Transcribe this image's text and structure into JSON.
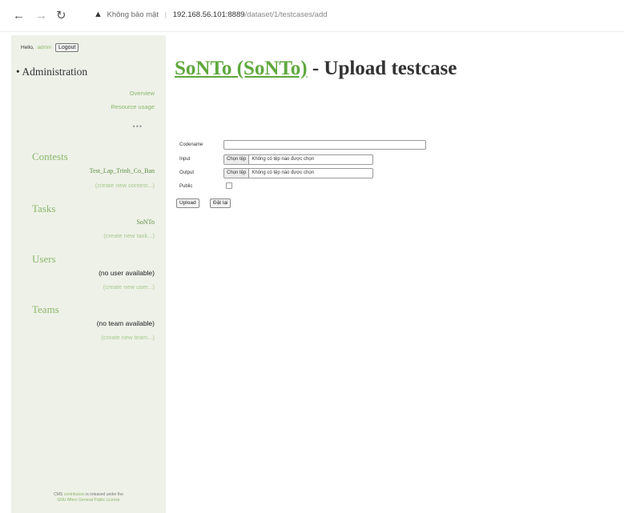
{
  "browser": {
    "security_text": "Không bảo mật",
    "url_host": "192.168.56.101:8889",
    "url_path": "/dataset/1/testcases/add"
  },
  "sidebar": {
    "greeting": "Hello,",
    "username": "admin",
    "logout_label": "Logout",
    "admin_title": "• Administration",
    "admin_links": [
      "Overview",
      "Resource usage"
    ],
    "admin_more": "•••",
    "contests": {
      "title": "Contests",
      "item": "Test_Lap_Trinh_Co_Ban",
      "create": "(create new contest...)"
    },
    "tasks": {
      "title": "Tasks",
      "item": "SoNTo",
      "create": "(create new task...)"
    },
    "users": {
      "title": "Users",
      "none": "(no user available)",
      "create": "(create new user...)"
    },
    "teams": {
      "title": "Teams",
      "none": "(no team available)",
      "create": "(create new team...)"
    },
    "footer_line1_a": "CMS",
    "footer_line1_link": "contributors",
    "footer_line1_b": "is released under the",
    "footer_line2": "GNU Affero General Public License"
  },
  "main": {
    "title_link": "SoNTo (SoNTo)",
    "title_rest": " - Upload testcase",
    "form": {
      "codename_label": "Codename",
      "input_label": "Input",
      "output_label": "Output",
      "public_label": "Public",
      "choose_file_label": "Chọn tệp",
      "no_file_text": "Không có tệp nào được chọn",
      "upload_label": "Upload",
      "reset_label": "Đặt lại"
    }
  }
}
